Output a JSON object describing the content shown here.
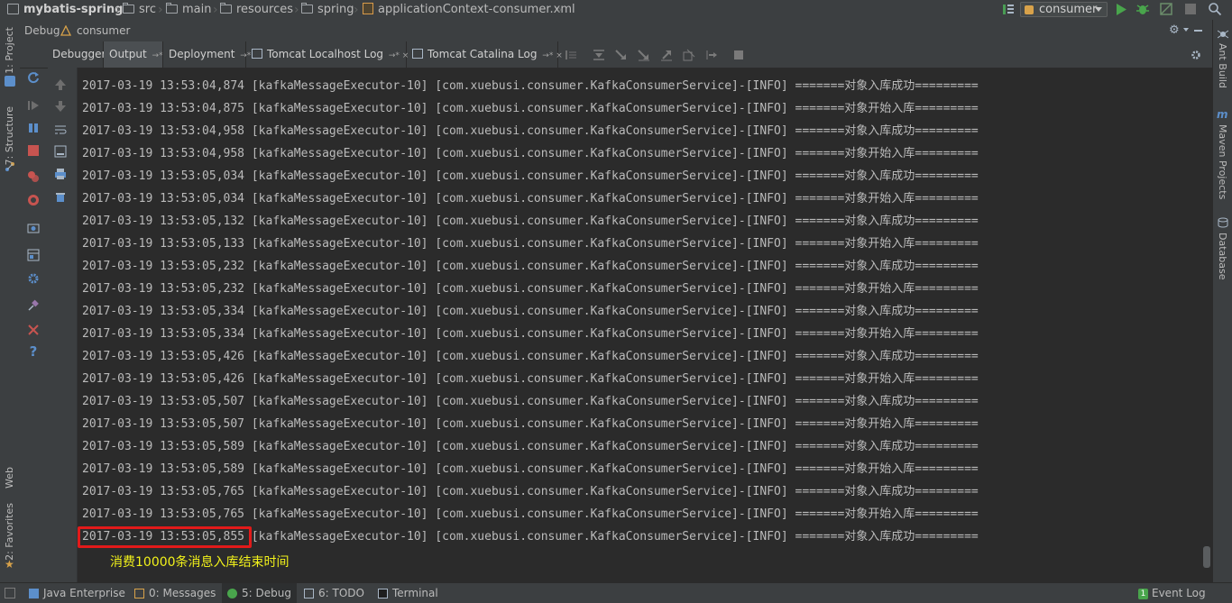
{
  "breadcrumbs": [
    "mybatis-spring",
    "src",
    "main",
    "resources",
    "spring",
    "applicationContext-consumer.xml"
  ],
  "run_config": "consumer",
  "debug_panel": {
    "title": "Debug",
    "session": "consumer"
  },
  "left_stripe": {
    "project": "1: Project",
    "structure": "7: Structure",
    "web": "Web",
    "favorites": "2: Favorites"
  },
  "right_stripe": {
    "ant": "Ant Build",
    "maven": "Maven Projects",
    "database": "Database"
  },
  "tabs": [
    {
      "label": "Debugger"
    },
    {
      "label": "Output",
      "suffix": "→*"
    },
    {
      "label": "Deployment",
      "suffix": "→*"
    },
    {
      "label": "Tomcat Localhost Log",
      "suffix": "→* ×"
    },
    {
      "label": "Tomcat Catalina Log",
      "suffix": "→* ×"
    }
  ],
  "log_lines": [
    "2017-03-19 13:53:04,874 [kafkaMessageExecutor-10] [com.xuebusi.consumer.KafkaConsumerService]-[INFO] =======对象入库成功=========",
    "2017-03-19 13:53:04,875 [kafkaMessageExecutor-10] [com.xuebusi.consumer.KafkaConsumerService]-[INFO] =======对象开始入库=========",
    "2017-03-19 13:53:04,958 [kafkaMessageExecutor-10] [com.xuebusi.consumer.KafkaConsumerService]-[INFO] =======对象入库成功=========",
    "2017-03-19 13:53:04,958 [kafkaMessageExecutor-10] [com.xuebusi.consumer.KafkaConsumerService]-[INFO] =======对象开始入库=========",
    "2017-03-19 13:53:05,034 [kafkaMessageExecutor-10] [com.xuebusi.consumer.KafkaConsumerService]-[INFO] =======对象入库成功=========",
    "2017-03-19 13:53:05,034 [kafkaMessageExecutor-10] [com.xuebusi.consumer.KafkaConsumerService]-[INFO] =======对象开始入库=========",
    "2017-03-19 13:53:05,132 [kafkaMessageExecutor-10] [com.xuebusi.consumer.KafkaConsumerService]-[INFO] =======对象入库成功=========",
    "2017-03-19 13:53:05,133 [kafkaMessageExecutor-10] [com.xuebusi.consumer.KafkaConsumerService]-[INFO] =======对象开始入库=========",
    "2017-03-19 13:53:05,232 [kafkaMessageExecutor-10] [com.xuebusi.consumer.KafkaConsumerService]-[INFO] =======对象入库成功=========",
    "2017-03-19 13:53:05,232 [kafkaMessageExecutor-10] [com.xuebusi.consumer.KafkaConsumerService]-[INFO] =======对象开始入库=========",
    "2017-03-19 13:53:05,334 [kafkaMessageExecutor-10] [com.xuebusi.consumer.KafkaConsumerService]-[INFO] =======对象入库成功=========",
    "2017-03-19 13:53:05,334 [kafkaMessageExecutor-10] [com.xuebusi.consumer.KafkaConsumerService]-[INFO] =======对象开始入库=========",
    "2017-03-19 13:53:05,426 [kafkaMessageExecutor-10] [com.xuebusi.consumer.KafkaConsumerService]-[INFO] =======对象入库成功=========",
    "2017-03-19 13:53:05,426 [kafkaMessageExecutor-10] [com.xuebusi.consumer.KafkaConsumerService]-[INFO] =======对象开始入库=========",
    "2017-03-19 13:53:05,507 [kafkaMessageExecutor-10] [com.xuebusi.consumer.KafkaConsumerService]-[INFO] =======对象入库成功=========",
    "2017-03-19 13:53:05,507 [kafkaMessageExecutor-10] [com.xuebusi.consumer.KafkaConsumerService]-[INFO] =======对象开始入库=========",
    "2017-03-19 13:53:05,589 [kafkaMessageExecutor-10] [com.xuebusi.consumer.KafkaConsumerService]-[INFO] =======对象入库成功=========",
    "2017-03-19 13:53:05,589 [kafkaMessageExecutor-10] [com.xuebusi.consumer.KafkaConsumerService]-[INFO] =======对象开始入库=========",
    "2017-03-19 13:53:05,765 [kafkaMessageExecutor-10] [com.xuebusi.consumer.KafkaConsumerService]-[INFO] =======对象入库成功=========",
    "2017-03-19 13:53:05,765 [kafkaMessageExecutor-10] [com.xuebusi.consumer.KafkaConsumerService]-[INFO] =======对象开始入库=========",
    "2017-03-19 13:53:05,855 [kafkaMessageExecutor-10] [com.xuebusi.consumer.KafkaConsumerService]-[INFO] =======对象入库成功========="
  ],
  "annotation": "消费10000条消息入库结束时间",
  "bottom_tabs": [
    {
      "label": "Java Enterprise"
    },
    {
      "label": "0: Messages"
    },
    {
      "label": "5: Debug"
    },
    {
      "label": "6: TODO"
    },
    {
      "label": "Terminal"
    },
    {
      "label": "Event Log",
      "count": "1"
    }
  ],
  "colors": {
    "highlight": "#e21a1a",
    "annotation": "#f2f21a",
    "run": "#49a54c",
    "stop": "#c75450"
  }
}
